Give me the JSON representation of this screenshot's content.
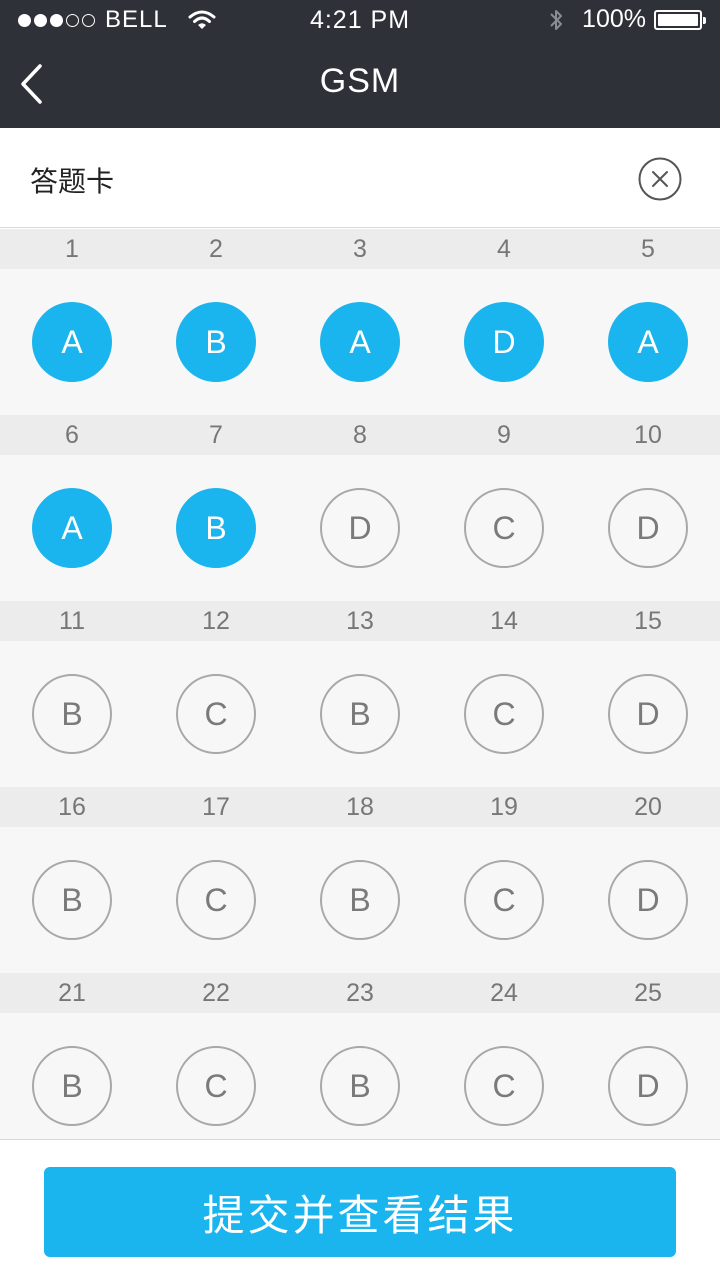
{
  "status_bar": {
    "carrier": "BELL",
    "time": "4:21 PM",
    "battery": "100%",
    "signal_bars_filled": 3,
    "signal_bars_total": 5
  },
  "nav": {
    "title": "GSM",
    "back_icon": "chevron-left-icon"
  },
  "sheet": {
    "title": "答题卡",
    "close_icon": "close-circle-icon"
  },
  "questions": [
    {
      "number": "1",
      "option": "A",
      "answered": true
    },
    {
      "number": "2",
      "option": "B",
      "answered": true
    },
    {
      "number": "3",
      "option": "A",
      "answered": true
    },
    {
      "number": "4",
      "option": "D",
      "answered": true
    },
    {
      "number": "5",
      "option": "A",
      "answered": true
    },
    {
      "number": "6",
      "option": "A",
      "answered": true
    },
    {
      "number": "7",
      "option": "B",
      "answered": true
    },
    {
      "number": "8",
      "option": "D",
      "answered": false
    },
    {
      "number": "9",
      "option": "C",
      "answered": false
    },
    {
      "number": "10",
      "option": "D",
      "answered": false
    },
    {
      "number": "11",
      "option": "B",
      "answered": false
    },
    {
      "number": "12",
      "option": "C",
      "answered": false
    },
    {
      "number": "13",
      "option": "B",
      "answered": false
    },
    {
      "number": "14",
      "option": "C",
      "answered": false
    },
    {
      "number": "15",
      "option": "D",
      "answered": false
    },
    {
      "number": "16",
      "option": "B",
      "answered": false
    },
    {
      "number": "17",
      "option": "C",
      "answered": false
    },
    {
      "number": "18",
      "option": "B",
      "answered": false
    },
    {
      "number": "19",
      "option": "C",
      "answered": false
    },
    {
      "number": "20",
      "option": "D",
      "answered": false
    },
    {
      "number": "21",
      "option": "B",
      "answered": false
    },
    {
      "number": "22",
      "option": "C",
      "answered": false
    },
    {
      "number": "23",
      "option": "B",
      "answered": false
    },
    {
      "number": "24",
      "option": "C",
      "answered": false
    },
    {
      "number": "25",
      "option": "D",
      "answered": false
    }
  ],
  "footer": {
    "submit_label": "提交并查看结果"
  },
  "colors": {
    "nav_background": "#2e3138",
    "accent": "#1ab4ee",
    "unanswered_border": "#a8a8a8",
    "number_strip": "#ececec",
    "grid_background": "#f7f7f7"
  }
}
